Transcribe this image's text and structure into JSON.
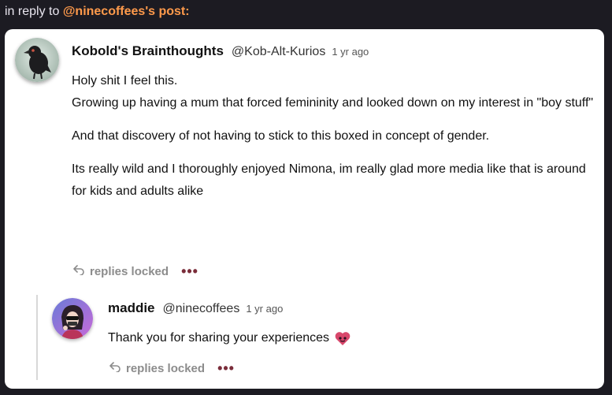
{
  "context": {
    "prefix": "in reply to ",
    "handle": "@ninecoffees's post:"
  },
  "post": {
    "display_name": "Kobold's Brainthoughts",
    "handle": "@Kob-Alt-Kurios",
    "time": "1 yr ago",
    "paragraphs": [
      "Holy shit I feel this.",
      "Growing up having a mum that forced femininity and looked down on my interest in \"boy stuff\"",
      "And that discovery of not having to stick to this boxed in concept of gender.",
      "Its really wild and I thoroughly enjoyed Nimona, im really glad more media like that is around for kids and adults alike"
    ],
    "replies_label": "replies locked",
    "more_label": "•••"
  },
  "reply": {
    "display_name": "maddie",
    "handle": "@ninecoffees",
    "time": "1 yr ago",
    "text": "Thank you for sharing your experiences",
    "replies_label": "replies locked",
    "more_label": "•••"
  },
  "icons": {
    "reply_arrow": "reply-arrow-icon",
    "more": "more-options-icon",
    "emoji": "custom-emoji-heart"
  },
  "colors": {
    "accent_handle": "#ff9a4b",
    "more_dots": "#7a2d3a",
    "muted": "#8c8c8c"
  }
}
